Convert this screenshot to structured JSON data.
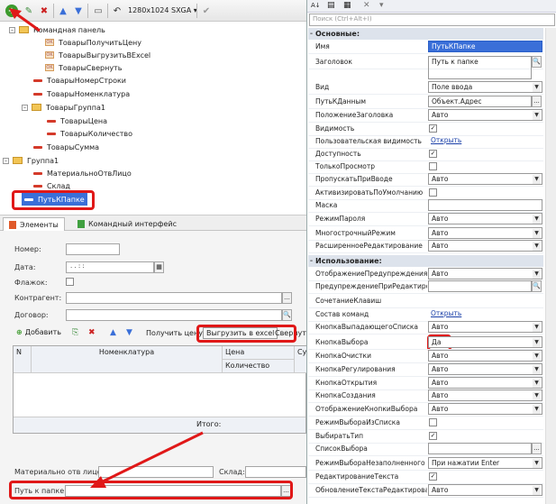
{
  "toolbar": {
    "resolution": "1280x1024 SXGA",
    "resolution_arrow": "▾",
    "check": "✔",
    "plus": "+",
    "edit": "✎",
    "del": "✖",
    "up": "▲",
    "down": "▼",
    "device": "▭",
    "rotate": "↶"
  },
  "tree": {
    "items": [
      {
        "label": "Командная панель",
        "icon": "folder-icon",
        "level": 1,
        "toggle": "–"
      },
      {
        "label": "ТоварыПолучитьЦену",
        "icon": "ok-icon",
        "level": 2
      },
      {
        "label": "ТоварыВыгрузитьВExcel",
        "icon": "ok-icon",
        "level": 2
      },
      {
        "label": "ТоварыСвернуть",
        "icon": "ok-icon",
        "level": 2
      },
      {
        "label": "ТоварыНомерСтроки",
        "icon": "field-icon",
        "level": 1
      },
      {
        "label": "ТоварыНоменклатура",
        "icon": "field-icon",
        "level": 1
      },
      {
        "label": "ТоварыГруппа1",
        "icon": "folder-icon",
        "level": 1,
        "toggle": "–"
      },
      {
        "label": "ТоварыЦена",
        "icon": "field-icon",
        "level": 2
      },
      {
        "label": "ТоварыКоличество",
        "icon": "field-icon",
        "level": 2
      },
      {
        "label": "ТоварыСумма",
        "icon": "field-icon",
        "level": 1
      },
      {
        "label": "Группа1",
        "icon": "folder-icon",
        "level": 0,
        "toggle": "–"
      },
      {
        "label": "МатериальноОтвЛицо",
        "icon": "field-icon",
        "level": 1
      },
      {
        "label": "Склад",
        "icon": "field-icon",
        "level": 1
      },
      {
        "label": "ПутьКПапке",
        "icon": "field-icon",
        "level": 0,
        "selected": true
      }
    ]
  },
  "tabs": {
    "elements": "Элементы",
    "cmd": "Командный интерфейс"
  },
  "form": {
    "nomer": "Номер:",
    "data": "Дата:",
    "date_mask": ".   .      :   :",
    "flag": "Флажок:",
    "kontr": "Контрагент:",
    "dogovor": "Договор:",
    "add": "Добавить",
    "get_price": "Получить цену",
    "export": "Выгрузить в excel",
    "collapse": "Свернуть",
    "col_n": "N",
    "col_nom": "Номенклатура",
    "col_price": "Цена",
    "col_qty": "Количество",
    "col_sum": "Су",
    "itogo": "Итого:",
    "mol": "Материально отв лицо:",
    "sklad": "Склад:",
    "path": "Путь к папке:",
    "ellipsis": "...",
    "search_icon": "🔍"
  },
  "right": {
    "search_placeholder": "Поиск (Ctrl+Alt+I)",
    "sec_main": "Основные:",
    "sec_use": "Использование:",
    "props_main": [
      {
        "name": "Имя",
        "value": "ПутьКПапке",
        "type": "selected-text"
      },
      {
        "name": "Заголовок",
        "value": "Путь к папке",
        "type": "text-area"
      },
      {
        "name": "Вид",
        "value": "Поле ввода",
        "type": "dropdown"
      },
      {
        "name": "ПутьКДанным",
        "value": "Объект.Адрес",
        "type": "ellipsis"
      },
      {
        "name": "ПоложениеЗаголовка",
        "value": "Авто",
        "type": "dropdown"
      },
      {
        "name": "Видимость",
        "value": "✓",
        "type": "check"
      },
      {
        "name": "Пользовательская видимость",
        "value": "Открыть",
        "type": "link"
      },
      {
        "name": "Доступность",
        "value": "✓",
        "type": "check"
      },
      {
        "name": "ТолькоПросмотр",
        "value": "",
        "type": "check"
      },
      {
        "name": "ПропускатьПриВводе",
        "value": "Авто",
        "type": "dropdown"
      },
      {
        "name": "АктивизироватьПоУмолчанию",
        "value": "",
        "type": "check"
      },
      {
        "name": "Маска",
        "value": "",
        "type": "input"
      },
      {
        "name": "РежимПароля",
        "value": "Авто",
        "type": "dropdown"
      },
      {
        "name": "МногострочныйРежим",
        "value": "Авто",
        "type": "dropdown"
      },
      {
        "name": "РасширенноеРедактирование",
        "value": "Авто",
        "type": "dropdown"
      }
    ],
    "props_use": [
      {
        "name": "ОтображениеПредупрежденияПр",
        "value": "Авто",
        "type": "dropdown"
      },
      {
        "name": "ПредупреждениеПриРедактиров",
        "value": "",
        "type": "search"
      },
      {
        "name": "СочетаниеКлавиш",
        "value": "",
        "type": "plain"
      },
      {
        "name": "Состав команд",
        "value": "Открыть",
        "type": "link"
      },
      {
        "name": "КнопкаВыпадающегоСписка",
        "value": "Авто",
        "type": "dropdown"
      },
      {
        "name": "КнопкаВыбора",
        "value": "Да",
        "type": "dropdown"
      },
      {
        "name": "КнопкаОчистки",
        "value": "Авто",
        "type": "dropdown"
      },
      {
        "name": "КнопкаРегулирования",
        "value": "Авто",
        "type": "dropdown"
      },
      {
        "name": "КнопкаОткрытия",
        "value": "Авто",
        "type": "dropdown"
      },
      {
        "name": "КнопкаСоздания",
        "value": "Авто",
        "type": "dropdown"
      },
      {
        "name": "ОтображениеКнопкиВыбора",
        "value": "Авто",
        "type": "dropdown"
      },
      {
        "name": "РежимВыбораИзСписка",
        "value": "",
        "type": "check"
      },
      {
        "name": "ВыбиратьТип",
        "value": "✓",
        "type": "check"
      },
      {
        "name": "СписокВыбора",
        "value": "",
        "type": "ellipsis"
      },
      {
        "name": "РежимВыбораНезаполненного",
        "value": "При нажатии Enter",
        "type": "dropdown"
      },
      {
        "name": "РедактированиеТекста",
        "value": "✓",
        "type": "check"
      },
      {
        "name": "ОбновлениеТекстаРедактирова",
        "value": "Авто",
        "type": "dropdown"
      }
    ],
    "rtb": {
      "sort": "A↓",
      "icon2": "▤",
      "icon3": "▦",
      "close": "✕",
      "nav": "▾"
    }
  },
  "colors": {
    "highlight": "#3a6fd8",
    "annotation": "#e01818"
  }
}
